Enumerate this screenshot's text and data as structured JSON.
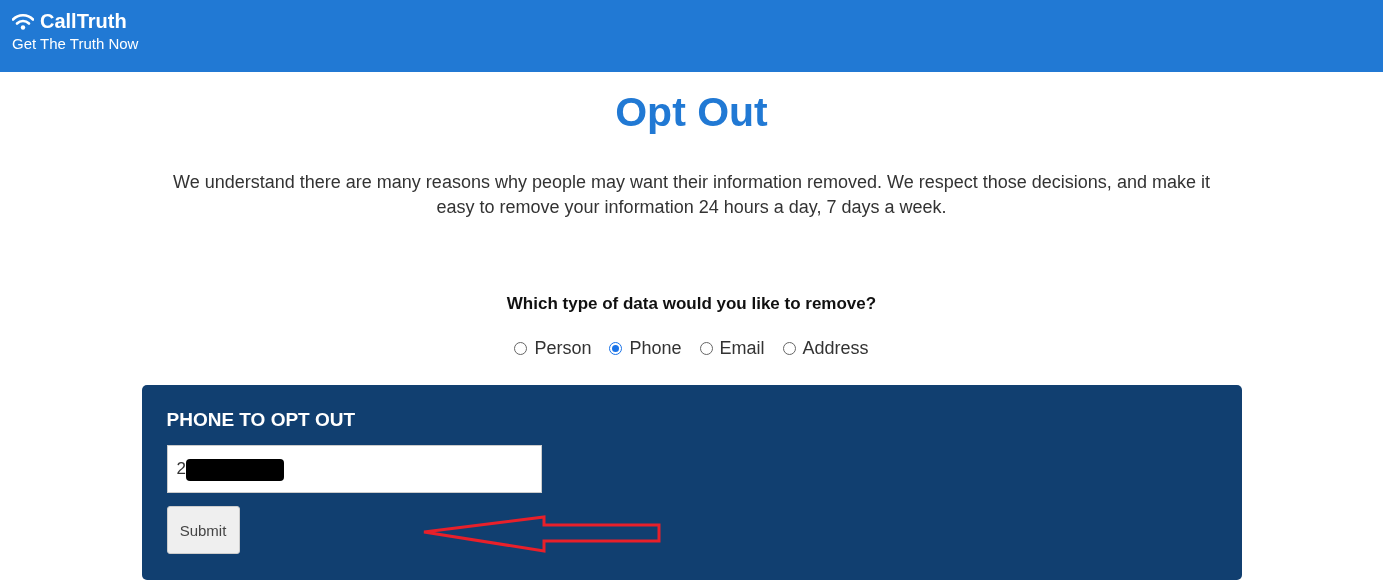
{
  "header": {
    "brand": "CallTruth",
    "tagline": "Get The Truth Now"
  },
  "title": "Opt Out",
  "intro": "We understand there are many reasons why people may want their information removed. We respect those decisions, and make it easy to remove your information 24 hours a day, 7 days a week.",
  "question": "Which type of data would you like to remove?",
  "options": [
    {
      "label": "Person",
      "selected": false
    },
    {
      "label": "Phone",
      "selected": true
    },
    {
      "label": "Email",
      "selected": false
    },
    {
      "label": "Address",
      "selected": false
    }
  ],
  "panel": {
    "heading": "PHONE TO OPT OUT",
    "value": "2",
    "button": "Submit"
  }
}
